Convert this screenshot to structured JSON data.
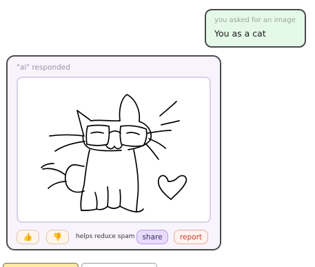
{
  "user_message": {
    "caption": "you asked for an image",
    "text": "You as a cat"
  },
  "ai_response": {
    "header": "\"ai\" responded",
    "image_description_icon": "cat-doodle-image",
    "actions": {
      "thumbs_up_icon": "thumbs-up-icon",
      "thumbs_down_icon": "thumbs-down-icon",
      "thumbs_up_glyph": "👍",
      "thumbs_down_glyph": "👎",
      "note": "helps reduce spam",
      "share_label": "share",
      "report_label": "report"
    }
  },
  "colors": {
    "user_bubble_bg": "#e4f9e8",
    "ai_card_bg": "#f8f4fd",
    "share_bg": "#e8dbfb",
    "report_text": "#cf3a23"
  }
}
